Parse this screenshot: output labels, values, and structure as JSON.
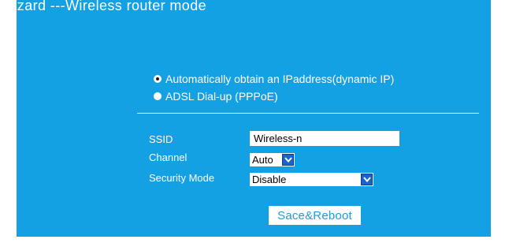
{
  "header": {
    "title": "Wizard  ---Wireless router mode"
  },
  "connection": {
    "options": [
      {
        "label": "Automatically obtain an IPaddress(dynamic IP)",
        "selected": true
      },
      {
        "label": "ADSL Dial-up (PPPoE)",
        "selected": false
      }
    ]
  },
  "form": {
    "ssid_label": "SSID",
    "ssid_value": "Wireless-n",
    "channel_label": "Channel",
    "channel_value": "Auto",
    "security_label": "Security  Mode",
    "security_value": "Disable"
  },
  "actions": {
    "save_label": "Sace&Reboot"
  },
  "colors": {
    "panel": "#13a1e4",
    "text": "#ffffff",
    "dropdown_arrow": "#1a63c9",
    "button_text": "#1a9de0"
  },
  "icons": {
    "dropdown": "chevron-down-icon",
    "radio": "radio-button"
  }
}
